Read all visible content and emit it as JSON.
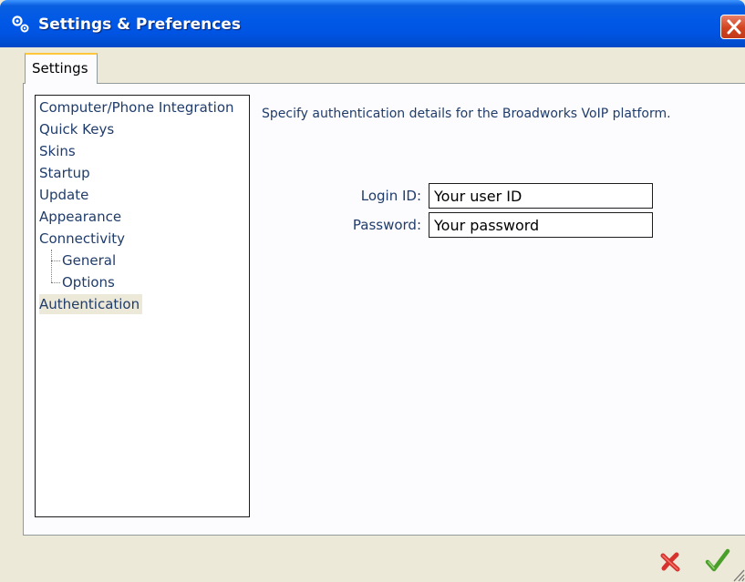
{
  "window": {
    "title": "Settings & Preferences"
  },
  "tabs": [
    {
      "label": "Settings"
    }
  ],
  "tree": {
    "items": [
      {
        "label": "Computer/Phone Integration"
      },
      {
        "label": "Quick Keys"
      },
      {
        "label": "Skins"
      },
      {
        "label": "Startup"
      },
      {
        "label": "Update"
      },
      {
        "label": "Appearance"
      },
      {
        "label": "Connectivity"
      },
      {
        "label": "General"
      },
      {
        "label": "Options"
      },
      {
        "label": "Authentication"
      }
    ],
    "selected": "Authentication"
  },
  "panel": {
    "description": "Specify authentication details for the Broadworks VoIP platform.",
    "login_label": "Login ID:",
    "login_value": "Your user ID",
    "password_label": "Password:",
    "password_value": "Your password"
  },
  "icons": {
    "title": "settings-gears-icon",
    "close": "close-icon",
    "cancel": "red-x-icon",
    "ok": "green-checkmark-icon",
    "grip": "resize-grip-icon"
  },
  "colors": {
    "titlebar": "#0054e3",
    "close_button": "#d2431f",
    "tab_accent": "#ffc83c",
    "cancel": "#d8322e",
    "ok": "#4a9e2a",
    "link_text": "#1f3c6b"
  }
}
